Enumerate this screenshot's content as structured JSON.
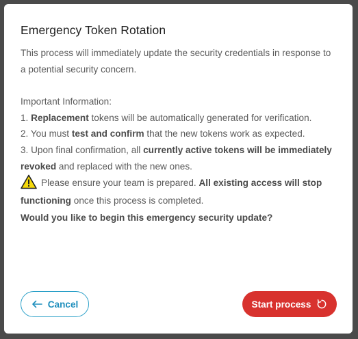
{
  "dialog": {
    "title": "Emergency Token Rotation",
    "intro": "This process will immediately update the security credentials in response to a potential security concern.",
    "info_heading": "Important Information:",
    "item1": {
      "prefix": "1. ",
      "bold": "Replacement",
      "rest": " tokens will be automatically generated for verification."
    },
    "item2": {
      "prefix": "2. You must ",
      "bold": "test and confirm",
      "rest": " that the new tokens work as expected."
    },
    "item3": {
      "prefix": "3. Upon final confirmation, all ",
      "bold": "currently active tokens will be immediately revoked",
      "rest": " and replaced with the new ones."
    },
    "warning": {
      "prefix": "Please ensure your team is prepared. ",
      "bold": "All existing access will stop functioning",
      "rest": " once this process is completed."
    },
    "question": "Would you like to begin this emergency security update?"
  },
  "buttons": {
    "cancel_label": "Cancel",
    "cancel_icon": "arrow-left-icon",
    "start_label": "Start process",
    "start_icon": "refresh-icon"
  },
  "colors": {
    "accent": "#1f8fbd",
    "danger": "#d8322e",
    "warning": "#f5d90a"
  }
}
